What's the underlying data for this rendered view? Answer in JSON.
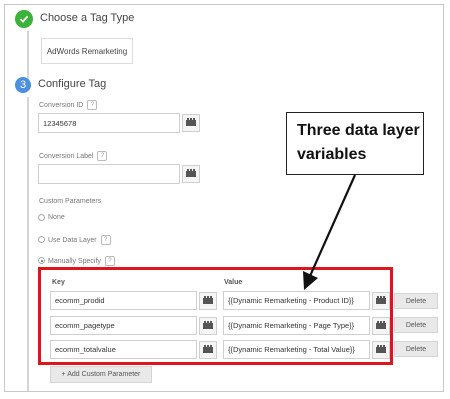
{
  "steps": {
    "tag_type": {
      "title": "Choose a Tag Type",
      "selected": "AdWords Remarketing"
    },
    "configure": {
      "number": "3",
      "title": "Configure Tag"
    }
  },
  "fields": {
    "conversion_id": {
      "label": "Conversion ID",
      "value": "12345678"
    },
    "conversion_label": {
      "label": "Conversion Label",
      "value": ""
    }
  },
  "custom_parameters": {
    "label": "Custom Parameters",
    "options": [
      "None",
      "Use Data Layer",
      "Manually Specify"
    ],
    "selected": "Manually Specify"
  },
  "table": {
    "key_header": "Key",
    "value_header": "Value",
    "rows": [
      {
        "key": "ecomm_prodid",
        "value": "{{Dynamic Remarketing - Product ID}}",
        "delete": "Delete"
      },
      {
        "key": "ecomm_pagetype",
        "value": "{{Dynamic Remarketing - Page Type}}",
        "delete": "Delete"
      },
      {
        "key": "ecomm_totalvalue",
        "value": "{{Dynamic Remarketing - Total Value}}",
        "delete": "Delete"
      }
    ],
    "add_label": "+ Add Custom Parameter"
  },
  "annotation": {
    "text_line1": "Three data layer",
    "text_line2": "variables",
    "highlight_color": "#e0141c"
  },
  "colors": {
    "check_green": "#3bb33b",
    "step_blue": "#4a8fe0"
  },
  "icons": {
    "variable": "variable-picker-icon",
    "check": "check-icon",
    "help": "help-icon"
  }
}
